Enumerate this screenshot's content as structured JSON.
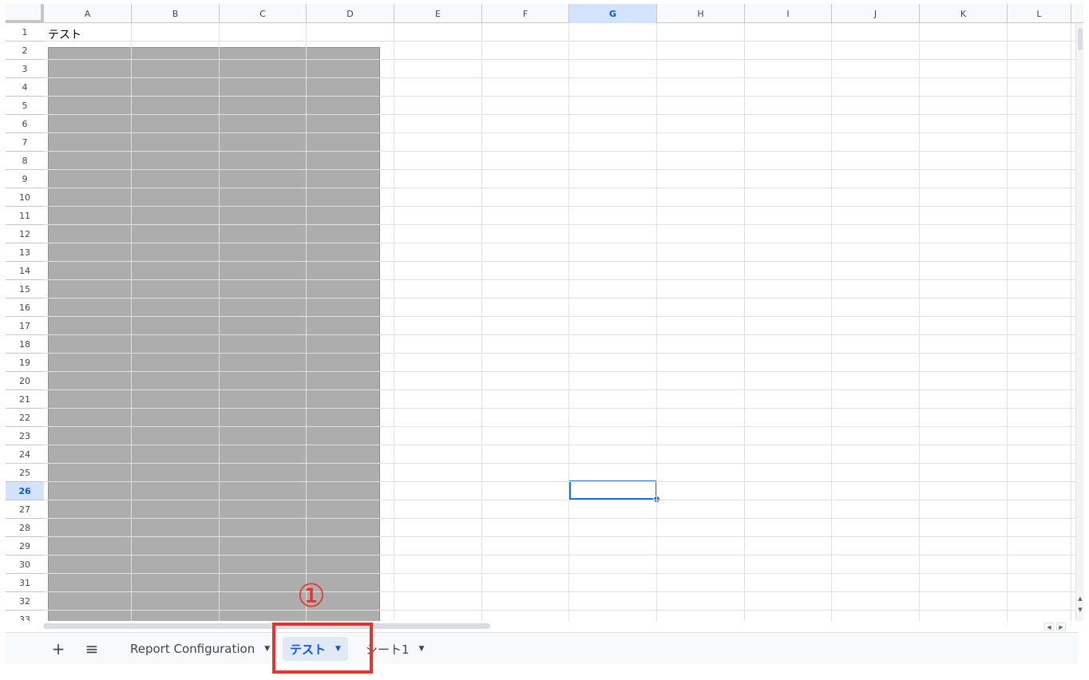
{
  "columns": [
    "A",
    "B",
    "C",
    "D",
    "E",
    "F",
    "G",
    "H",
    "I",
    "J",
    "K",
    "L"
  ],
  "selected_column": "G",
  "rows": [
    "1",
    "2",
    "3",
    "4",
    "5",
    "6",
    "7",
    "8",
    "9",
    "10",
    "11",
    "12",
    "13",
    "14",
    "15",
    "16",
    "17",
    "18",
    "19",
    "20",
    "21",
    "22",
    "23",
    "24",
    "25",
    "26",
    "27",
    "28",
    "29",
    "30",
    "31",
    "32",
    "33"
  ],
  "selected_row": "26",
  "cells": {
    "A1": "テスト"
  },
  "tabs": [
    {
      "label": "Report Configuration",
      "active": false
    },
    {
      "label": "テスト",
      "active": true
    },
    {
      "label": "シート1",
      "active": false
    }
  ],
  "toolbar": {
    "add_sheet": "+",
    "all_sheets": "≡"
  },
  "annotation": {
    "marker": "①",
    "color": "#e8322d"
  },
  "colors": {
    "accent": "#1a73e8",
    "selected_header": "#d3e3fd"
  }
}
